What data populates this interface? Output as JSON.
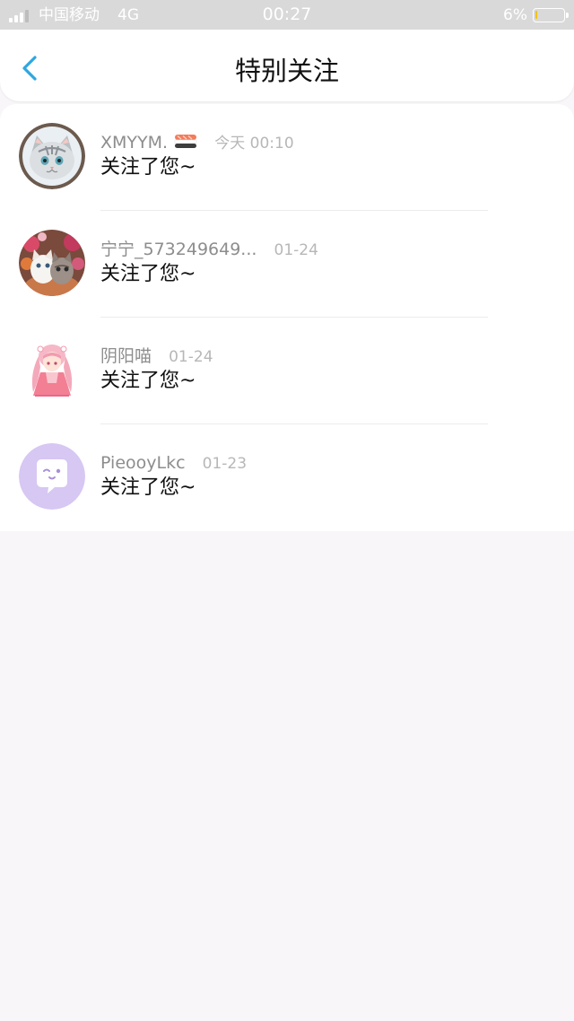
{
  "status_bar": {
    "carrier": "中国移动",
    "network": "4G",
    "time": "00:27",
    "battery_percent": "6%",
    "battery_level": 0.06
  },
  "nav": {
    "back_icon": "chevron-left-icon",
    "title": "特别关注"
  },
  "items": [
    {
      "name": "XMYYM.",
      "name_emoji": "sushi-emoji-icon",
      "time": "今天 00:10",
      "message": "关注了您~",
      "avatar": "cat-avatar"
    },
    {
      "name": "宁宁_573249649...",
      "time": "01-24",
      "message": "关注了您~",
      "avatar": "kittens-avatar"
    },
    {
      "name": "阴阳喵",
      "time": "01-24",
      "message": "关注了您~",
      "avatar": "anime-girl-avatar"
    },
    {
      "name": "PieooyLkc",
      "time": "01-23",
      "message": "关注了您~",
      "avatar": "default-chat-avatar"
    }
  ],
  "colors": {
    "accent": "#2ea7e0",
    "default_avatar_bg": "#d7c7f3",
    "status_bar_bg": "#d9d9d9"
  }
}
